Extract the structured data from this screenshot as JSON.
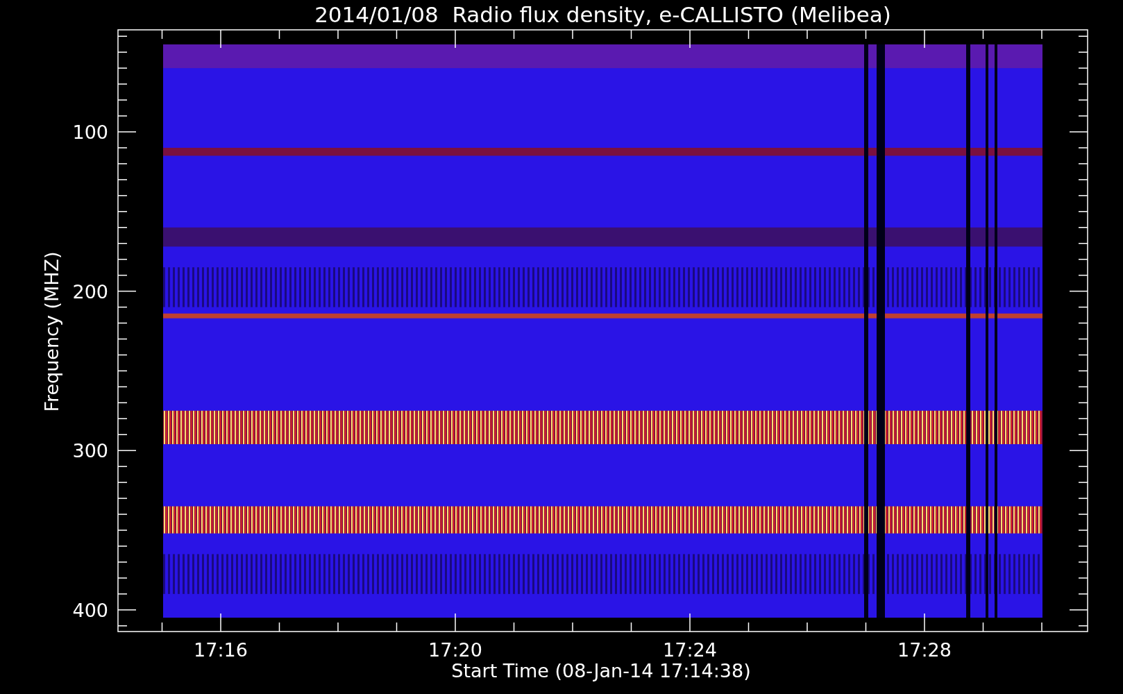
{
  "title": "2014/01/08  Radio flux density, e-CALLISTO (Melibea)",
  "y_axis": {
    "label": "Frequency (MHZ)",
    "ticks": [
      "100",
      "200",
      "300",
      "400"
    ]
  },
  "x_axis": {
    "label": "Start Time (08-Jan-14 17:14:38)",
    "ticks": [
      "17:16",
      "17:20",
      "17:24",
      "17:28"
    ]
  }
}
